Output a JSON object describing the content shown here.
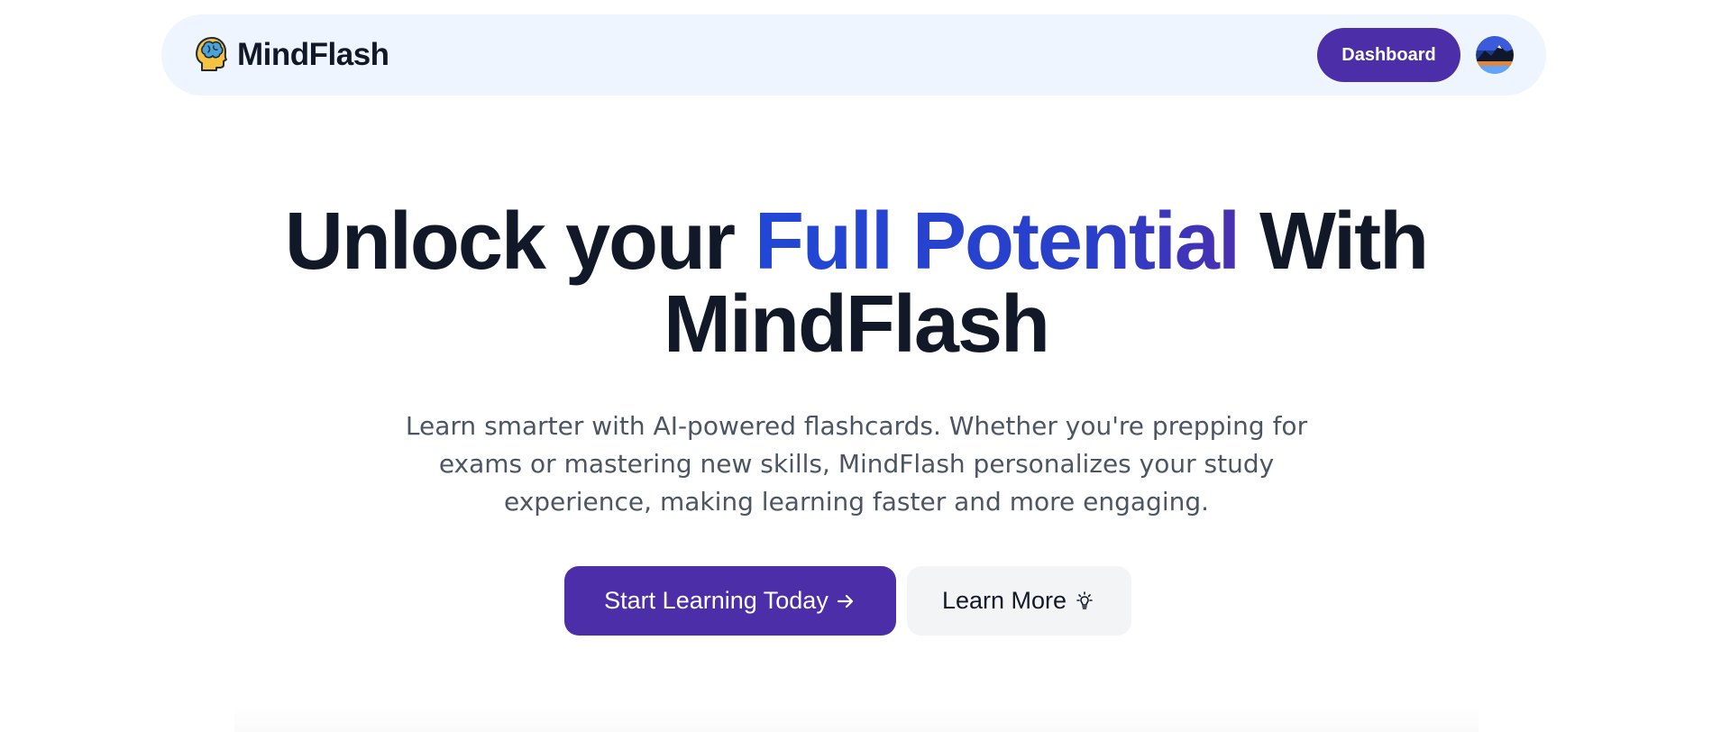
{
  "header": {
    "brand_name": "MindFlash",
    "brand_icon": "brain-head-icon",
    "dashboard_label": "Dashboard",
    "avatar_icon": "user-avatar"
  },
  "hero": {
    "title_part1": "Unlock your ",
    "title_highlight": "Full Potential",
    "title_part2": " With",
    "title_line2": "MindFlash",
    "subtitle": "Learn smarter with AI-powered flashcards. Whether you're prepping for exams or mastering new skills, MindFlash personalizes your study experience, making learning faster and more engaging.",
    "primary_cta": "Start Learning Today",
    "primary_cta_icon": "arrow-right-icon",
    "secondary_cta": "Learn More",
    "secondary_cta_icon": "lightbulb-icon"
  },
  "colors": {
    "primary": "#4c2fa8",
    "accent_gradient_start": "#2147d6",
    "accent_gradient_end": "#4a2fb0",
    "navbar_bg": "#eef5fe",
    "heading": "#111827",
    "body_text": "#4b5563",
    "secondary_btn_bg": "#f3f4f6"
  }
}
